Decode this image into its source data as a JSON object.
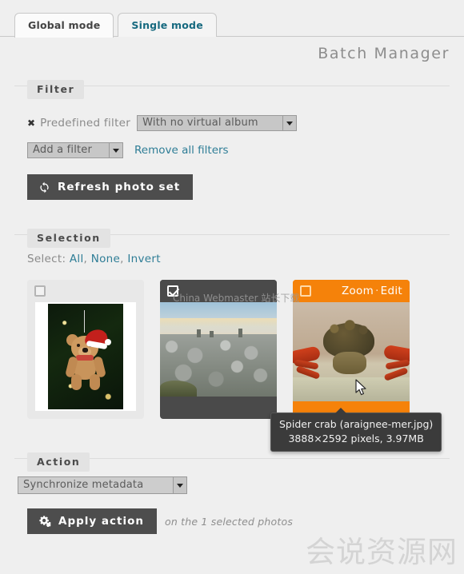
{
  "tabs": [
    {
      "label": "Global mode",
      "active": true
    },
    {
      "label": "Single mode",
      "active": false
    }
  ],
  "page_title": "Batch Manager",
  "filter": {
    "legend": "Filter",
    "remove_icon": "✖",
    "predefined_label": "Predefined filter",
    "predefined_value": "With no virtual album",
    "add_filter_value": "Add a filter",
    "remove_all_label": "Remove all filters",
    "refresh_label": "Refresh photo set",
    "refresh_icon": "refresh-icon"
  },
  "selection": {
    "legend": "Selection",
    "select_label": "Select:",
    "all_label": "All",
    "none_label": "None",
    "invert_label": "Invert",
    "comma": ",",
    "thumbs": [
      {
        "name": "christmas-teddy-bear",
        "checked": false,
        "state": "idle",
        "zoom_label": "",
        "edit_label": ""
      },
      {
        "name": "stone-cairns-landscape",
        "checked": true,
        "state": "selected",
        "zoom_label": "",
        "edit_label": ""
      },
      {
        "name": "spider-crab",
        "checked": false,
        "state": "hover",
        "zoom_label": "Zoom",
        "separator": "·",
        "edit_label": "Edit"
      }
    ]
  },
  "tooltip": {
    "title": "Spider crab (araignee-mer.jpg)",
    "details": "3888×2592 pixels, 3.97MB"
  },
  "action": {
    "legend": "Action",
    "selected_action": "Synchronize metadata",
    "apply_label": "Apply action",
    "apply_icon": "cogs-icon",
    "note": "on the 1 selected photos"
  },
  "watermarks": {
    "bottom": "会说资源网",
    "top": "China Webmaster 站长下载"
  },
  "colors": {
    "accent_orange": "#f5820a",
    "link_teal": "#2e7d96",
    "button_dark": "#4d4d4d",
    "selected_dark": "#4a4a4a",
    "page_bg": "#efefef"
  }
}
